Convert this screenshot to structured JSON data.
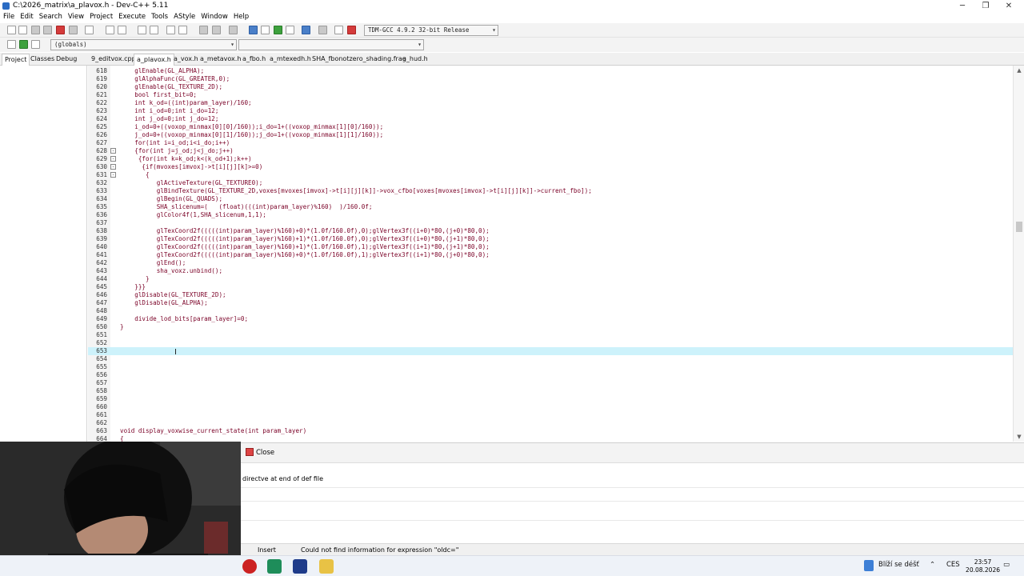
{
  "window": {
    "title": "C:\\2026_matrix\\a_plavox.h - Dev-C++ 5.11",
    "minimize": "─",
    "maximize": "❐",
    "close": "✕"
  },
  "menu": [
    "File",
    "Edit",
    "Search",
    "View",
    "Project",
    "Execute",
    "Tools",
    "AStyle",
    "Window",
    "Help"
  ],
  "toolbar": {
    "compiler": "TDM-GCC 4.9.2 32-bit Release",
    "scope": "(globals)"
  },
  "panel_tabs": [
    "Project",
    "Classes",
    "Debug"
  ],
  "file_tabs": [
    "9_editvox.cpp",
    "a_plavox.h",
    "a_vox.h",
    "a_metavox.h",
    "a_fbo.h",
    "a_mtexedh.h",
    "SHA_fbonotzero_shading.frag",
    "a_hud.h"
  ],
  "active_tab": "a_plavox.h",
  "code_lines": [
    {
      "n": "618",
      "t": "    glEnable(GL_ALPHA);"
    },
    {
      "n": "619",
      "t": "    glAlphaFunc(GL_GREATER,0);"
    },
    {
      "n": "620",
      "t": "    glEnable(GL_TEXTURE_2D);"
    },
    {
      "n": "621",
      "t": "    bool first_bit=0;"
    },
    {
      "n": "622",
      "t": "    int k_od=((int)param_layer)/160;"
    },
    {
      "n": "623",
      "t": "    int i_od=0;int i_do=12;"
    },
    {
      "n": "624",
      "t": "    int j_od=0;int j_do=12;"
    },
    {
      "n": "625",
      "t": "    i_od=0+((voxop_minmax[0][0]/160));i_do=1+((voxop_minmax[1][0]/160));"
    },
    {
      "n": "626",
      "t": "    j_od=0+((voxop_minmax[0][1]/160));j_do=1+((voxop_minmax[1][1]/160));"
    },
    {
      "n": "627",
      "t": "    for(int i=i_od;i<i_do;i++)"
    },
    {
      "n": "628",
      "t": "    {for(int j=j_od;j<j_do;j++)"
    },
    {
      "n": "629",
      "t": "     {for(int k=k_od;k<(k_od+1);k++)"
    },
    {
      "n": "630",
      "t": "      {if(mvoxes[imvox]->t[i][j][k]>=0)"
    },
    {
      "n": "631",
      "t": "       {"
    },
    {
      "n": "632",
      "t": "          glActiveTexture(GL_TEXTURE0);"
    },
    {
      "n": "633",
      "t": "          glBindTexture(GL_TEXTURE_2D,voxes[mvoxes[imvox]->t[i][j][k]]->vox_cfbo[voxes[mvoxes[imvox]->t[i][j][k]]->current_fbo]);"
    },
    {
      "n": "634",
      "t": "          glBegin(GL_QUADS);"
    },
    {
      "n": "635",
      "t": "          SHA_slicenum=(   (float)(((int)param_layer)%160)  )/160.0f;"
    },
    {
      "n": "636",
      "t": "          glColor4f(1,SHA_slicenum,1,1);"
    },
    {
      "n": "637",
      "t": ""
    },
    {
      "n": "638",
      "t": "          glTexCoord2f(((((int)param_layer)%160)+0)*(1.0f/160.0f),0);glVertex3f((i+0)*80,(j+0)*80,0);"
    },
    {
      "n": "639",
      "t": "          glTexCoord2f(((((int)param_layer)%160)+1)*(1.0f/160.0f),0);glVertex3f((i+0)*80,(j+1)*80,0);"
    },
    {
      "n": "640",
      "t": "          glTexCoord2f(((((int)param_layer)%160)+1)*(1.0f/160.0f),1);glVertex3f((i+1)*80,(j+1)*80,0);"
    },
    {
      "n": "641",
      "t": "          glTexCoord2f(((((int)param_layer)%160)+0)*(1.0f/160.0f),1);glVertex3f((i+1)*80,(j+0)*80,0);"
    },
    {
      "n": "642",
      "t": "          glEnd();"
    },
    {
      "n": "643",
      "t": "          sha_voxz.unbind();"
    },
    {
      "n": "644",
      "t": "       }"
    },
    {
      "n": "645",
      "t": "    }}}"
    },
    {
      "n": "646",
      "t": "    glDisable(GL_TEXTURE_2D);"
    },
    {
      "n": "647",
      "t": "    glDisable(GL_ALPHA);"
    },
    {
      "n": "648",
      "t": ""
    },
    {
      "n": "649",
      "t": "    divide_lod_bits[param_layer]=0;"
    },
    {
      "n": "650",
      "t": "}"
    },
    {
      "n": "651",
      "t": ""
    },
    {
      "n": "652",
      "t": ""
    },
    {
      "n": "653",
      "t": ""
    },
    {
      "n": "654",
      "t": ""
    },
    {
      "n": "655",
      "t": ""
    },
    {
      "n": "656",
      "t": ""
    },
    {
      "n": "657",
      "t": ""
    },
    {
      "n": "658",
      "t": ""
    },
    {
      "n": "659",
      "t": ""
    },
    {
      "n": "660",
      "t": ""
    },
    {
      "n": "661",
      "t": ""
    },
    {
      "n": "662",
      "t": ""
    },
    {
      "n": "663",
      "t": "void display_voxwise_current_state(int param_layer)"
    },
    {
      "n": "664",
      "t": "{"
    }
  ],
  "current_line": "653",
  "bottom": {
    "close_label": "Close",
    "message": "directve at end of def file"
  },
  "status": {
    "mode": "Insert",
    "message": "Could not find information for expression \"oldc=\""
  },
  "taskbar": {
    "weather": "Blíží se déšť",
    "lang": "CES",
    "time": "23:57",
    "date": "20.08.2026"
  }
}
